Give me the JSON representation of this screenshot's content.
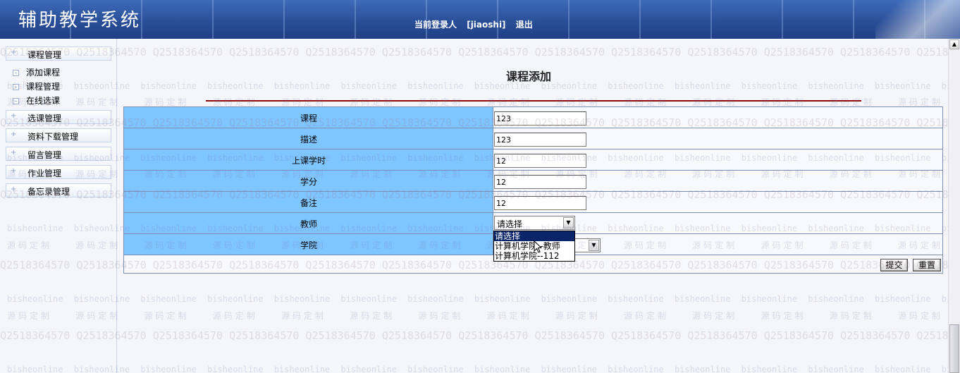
{
  "header": {
    "app_title": "辅助教学系统",
    "login_label": "当前登录人",
    "username": "[jiaoshi]",
    "logout": "退出"
  },
  "watermark": {
    "site": "bisheonline",
    "qq": "Q2518364570",
    "custom": "源码定制"
  },
  "sidebar": {
    "groups": [
      {
        "label": "课程管理",
        "subitems": [
          "添加课程",
          "课程管理",
          "在线选课"
        ]
      },
      {
        "label": "选课管理"
      },
      {
        "label": "资料下载管理"
      },
      {
        "label": "留言管理"
      },
      {
        "label": "作业管理"
      },
      {
        "label": "备忘录管理"
      }
    ]
  },
  "main": {
    "title": "课程添加",
    "fields": [
      {
        "label": "课程",
        "value": "123"
      },
      {
        "label": "描述",
        "value": "123"
      },
      {
        "label": "上课学时",
        "value": "12"
      },
      {
        "label": "学分",
        "value": "12"
      },
      {
        "label": "备注",
        "value": "12"
      }
    ],
    "teacher": {
      "label": "教师",
      "selected": "请选择",
      "options": [
        "请选择",
        "计算机学院--教师",
        "计算机学院--112"
      ]
    },
    "college": {
      "label": "学院"
    },
    "buttons": {
      "submit": "提交",
      "reset": "重置"
    }
  },
  "colors": {
    "label_cell": "#7fc5ff",
    "header_blue": "#2a4f98",
    "title_rule": "#8b0000",
    "selected_option": "#0a246a"
  },
  "icons": [
    "plus-icon",
    "dropdown-arrow-icon",
    "mouse-cursor-icon",
    "scroll-up-icon"
  ]
}
